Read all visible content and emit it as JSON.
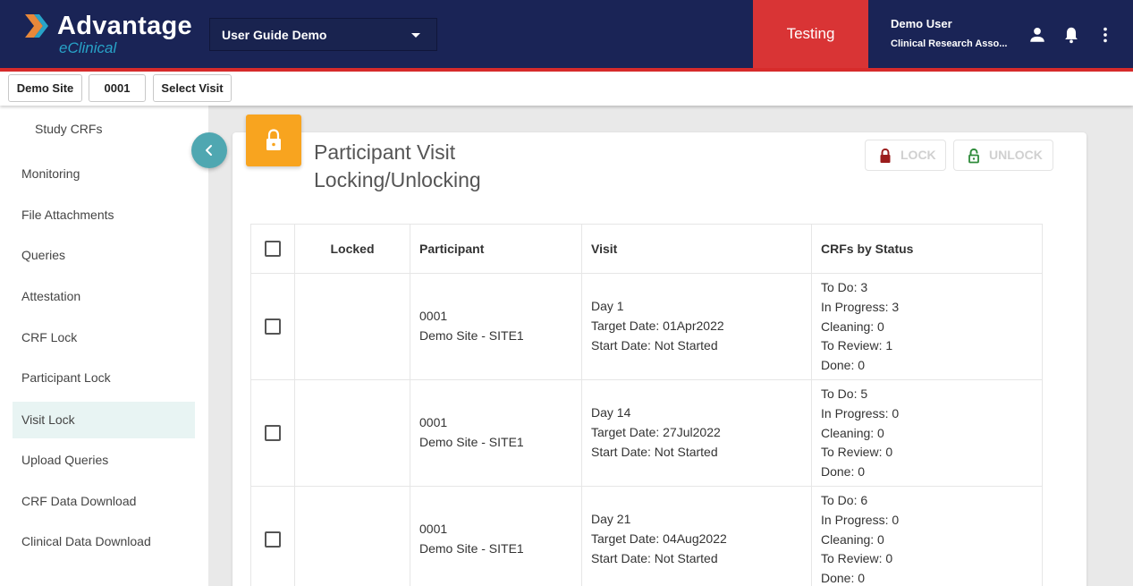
{
  "header": {
    "logo_title": "Advantage",
    "logo_subtitle": "eClinical",
    "study_select": "User Guide Demo",
    "environment": "Testing",
    "user_name": "Demo User",
    "user_role": "Clinical Research Asso..."
  },
  "context": {
    "site": "Demo Site",
    "participant": "0001",
    "visit": "Select Visit"
  },
  "sidebar": {
    "items": [
      {
        "label": "Study CRFs"
      },
      {
        "label": "Monitoring"
      },
      {
        "label": "File Attachments"
      },
      {
        "label": "Queries"
      },
      {
        "label": "Attestation"
      },
      {
        "label": "CRF Lock"
      },
      {
        "label": "Participant Lock"
      },
      {
        "label": "Visit Lock"
      },
      {
        "label": "Upload Queries"
      },
      {
        "label": "CRF Data Download"
      },
      {
        "label": "Clinical Data Download"
      }
    ],
    "active": "Visit Lock"
  },
  "page": {
    "title": "Participant Visit Locking/Unlocking",
    "lock_label": "LOCK",
    "unlock_label": "UNLOCK"
  },
  "table": {
    "columns": [
      "Locked",
      "Participant",
      "Visit",
      "CRFs by Status"
    ],
    "rows": [
      {
        "locked": "",
        "participant_id": "0001",
        "participant_site": "Demo Site - SITE1",
        "visit_name": "Day 1",
        "target_date": "Target Date: 01Apr2022",
        "start_date": "Start Date: Not Started",
        "todo": "To Do: 3",
        "in_progress": "In Progress: 3",
        "cleaning": "Cleaning: 0",
        "to_review": "To Review: 1",
        "done": "Done: 0"
      },
      {
        "locked": "",
        "participant_id": "0001",
        "participant_site": "Demo Site - SITE1",
        "visit_name": "Day 14",
        "target_date": "Target Date: 27Jul2022",
        "start_date": "Start Date: Not Started",
        "todo": "To Do: 5",
        "in_progress": "In Progress: 0",
        "cleaning": "Cleaning: 0",
        "to_review": "To Review: 0",
        "done": "Done: 0"
      },
      {
        "locked": "",
        "participant_id": "0001",
        "participant_site": "Demo Site - SITE1",
        "visit_name": "Day 21",
        "target_date": "Target Date: 04Aug2022",
        "start_date": "Start Date: Not Started",
        "todo": "To Do: 6",
        "in_progress": "In Progress: 0",
        "cleaning": "Cleaning: 0",
        "to_review": "To Review: 0",
        "done": "Done: 0"
      }
    ]
  },
  "colors": {
    "header_bg": "#1a2456",
    "accent_red": "#d93435",
    "accent_teal": "#4fa7b1",
    "lock_icon_orange": "#f8a41f",
    "active_nav_bg": "#e8f4f3"
  }
}
